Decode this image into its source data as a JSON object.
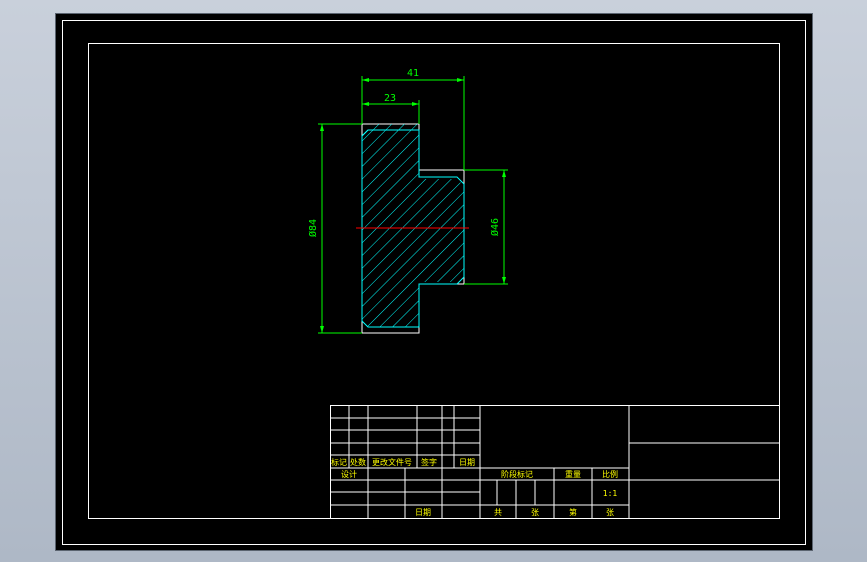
{
  "colors": {
    "background": "#000000",
    "frame": "#ffffff",
    "outline": "#ffffff",
    "hatch": "#00ffff",
    "dimension": "#00ff00",
    "centerline": "#ff0000",
    "title_text": "#ffff00"
  },
  "dimensions": {
    "overall_width": "41",
    "flange_width": "23",
    "outer_diameter": "Ø84",
    "hub_diameter": "Ø46"
  },
  "title_block": {
    "rev_headers": [
      "标记",
      "处数",
      "更改文件号",
      "签字",
      "日期"
    ],
    "design": "设计",
    "date": "日期",
    "stage_label": "阶段标记",
    "weight_label": "重量",
    "scale_label": "比例",
    "scale_value": "1:1",
    "total_label": "共",
    "sheets_label": "张",
    "sheet_label": "第",
    "sheet_suffix": "张"
  }
}
